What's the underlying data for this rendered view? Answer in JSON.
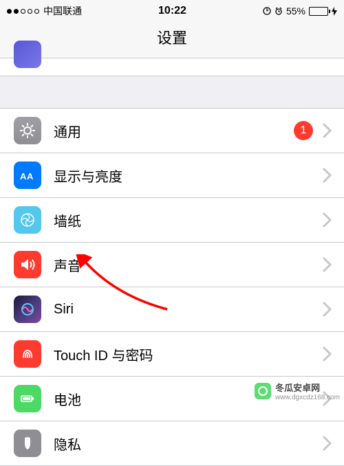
{
  "status": {
    "carrier": "中国联通",
    "time": "10:22",
    "battery_percent": "55%"
  },
  "nav": {
    "title": "设置"
  },
  "rows": {
    "general": {
      "label": "通用",
      "badge": "1"
    },
    "display": {
      "label": "显示与亮度"
    },
    "wallpaper": {
      "label": "墙纸"
    },
    "sound": {
      "label": "声音"
    },
    "siri": {
      "label": "Siri"
    },
    "touchid": {
      "label": "Touch ID 与密码"
    },
    "battery": {
      "label": "电池"
    },
    "privacy": {
      "label": "隐私"
    }
  },
  "watermark": {
    "line1": "冬瓜安卓网",
    "line2": "www.dgxcdz168.com"
  }
}
